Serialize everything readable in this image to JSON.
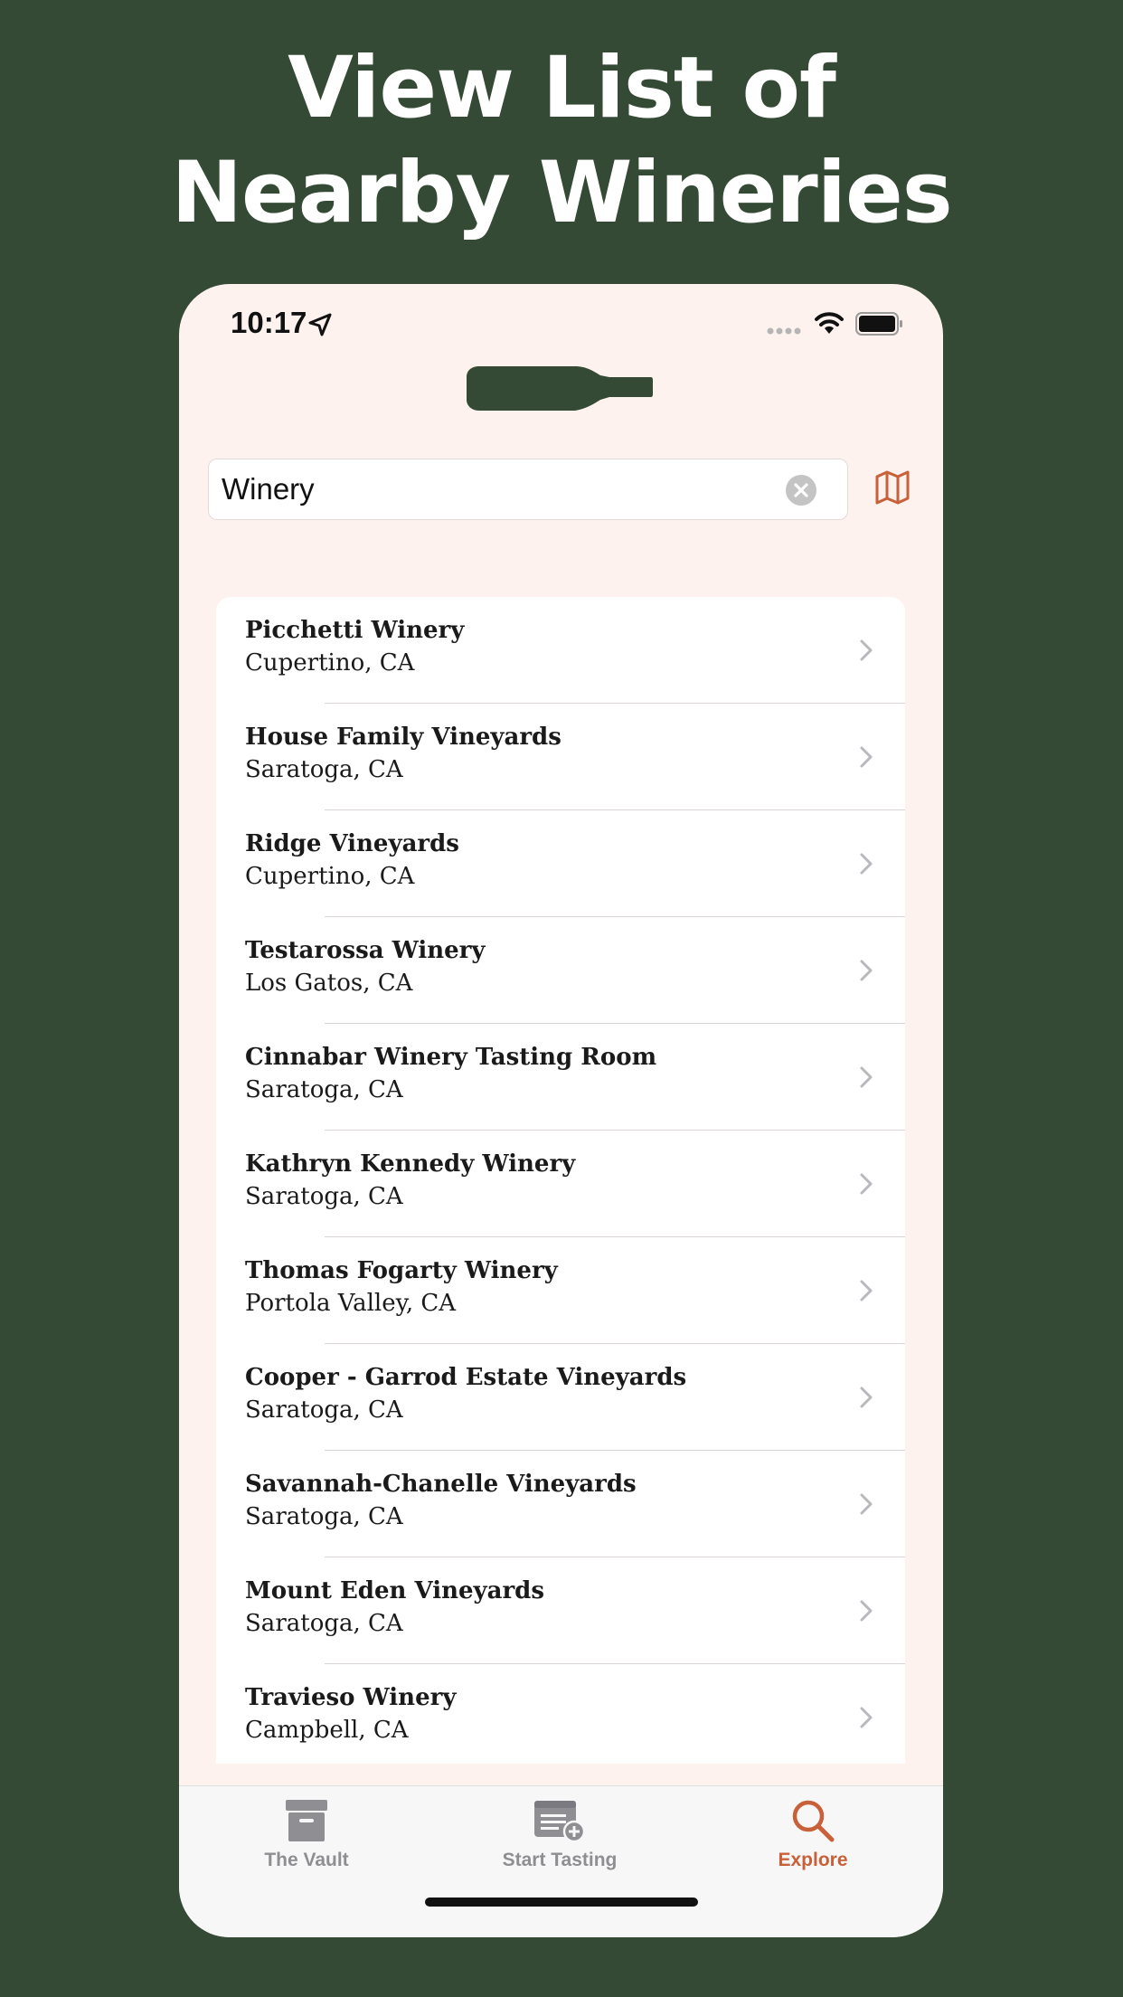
{
  "headline": {
    "line1": "View List of",
    "line2": "Nearby Wineries"
  },
  "status_bar": {
    "time": "10:17"
  },
  "search": {
    "value": "Winery"
  },
  "wineries": [
    {
      "name": "Picchetti Winery",
      "location": "Cupertino, CA"
    },
    {
      "name": "House Family Vineyards",
      "location": "Saratoga, CA"
    },
    {
      "name": "Ridge Vineyards",
      "location": "Cupertino, CA"
    },
    {
      "name": "Testarossa Winery",
      "location": "Los Gatos, CA"
    },
    {
      "name": "Cinnabar Winery Tasting Room",
      "location": "Saratoga, CA"
    },
    {
      "name": "Kathryn Kennedy Winery",
      "location": "Saratoga, CA"
    },
    {
      "name": "Thomas Fogarty Winery",
      "location": "Portola Valley, CA"
    },
    {
      "name": "Cooper - Garrod Estate Vineyards",
      "location": "Saratoga, CA"
    },
    {
      "name": "Savannah-Chanelle Vineyards",
      "location": "Saratoga, CA"
    },
    {
      "name": "Mount Eden Vineyards",
      "location": "Saratoga, CA"
    },
    {
      "name": "Travieso Winery",
      "location": "Campbell, CA"
    }
  ],
  "tabs": [
    {
      "label": "The Vault",
      "icon": "archive-box-icon",
      "active": false
    },
    {
      "label": "Start Tasting",
      "icon": "tasting-note-add-icon",
      "active": false
    },
    {
      "label": "Explore",
      "icon": "magnifying-glass-icon",
      "active": true
    }
  ],
  "colors": {
    "background": "#344a35",
    "screen": "#fdf2ee",
    "accent": "#c8603a",
    "tab_inactive": "#8e8e93"
  }
}
